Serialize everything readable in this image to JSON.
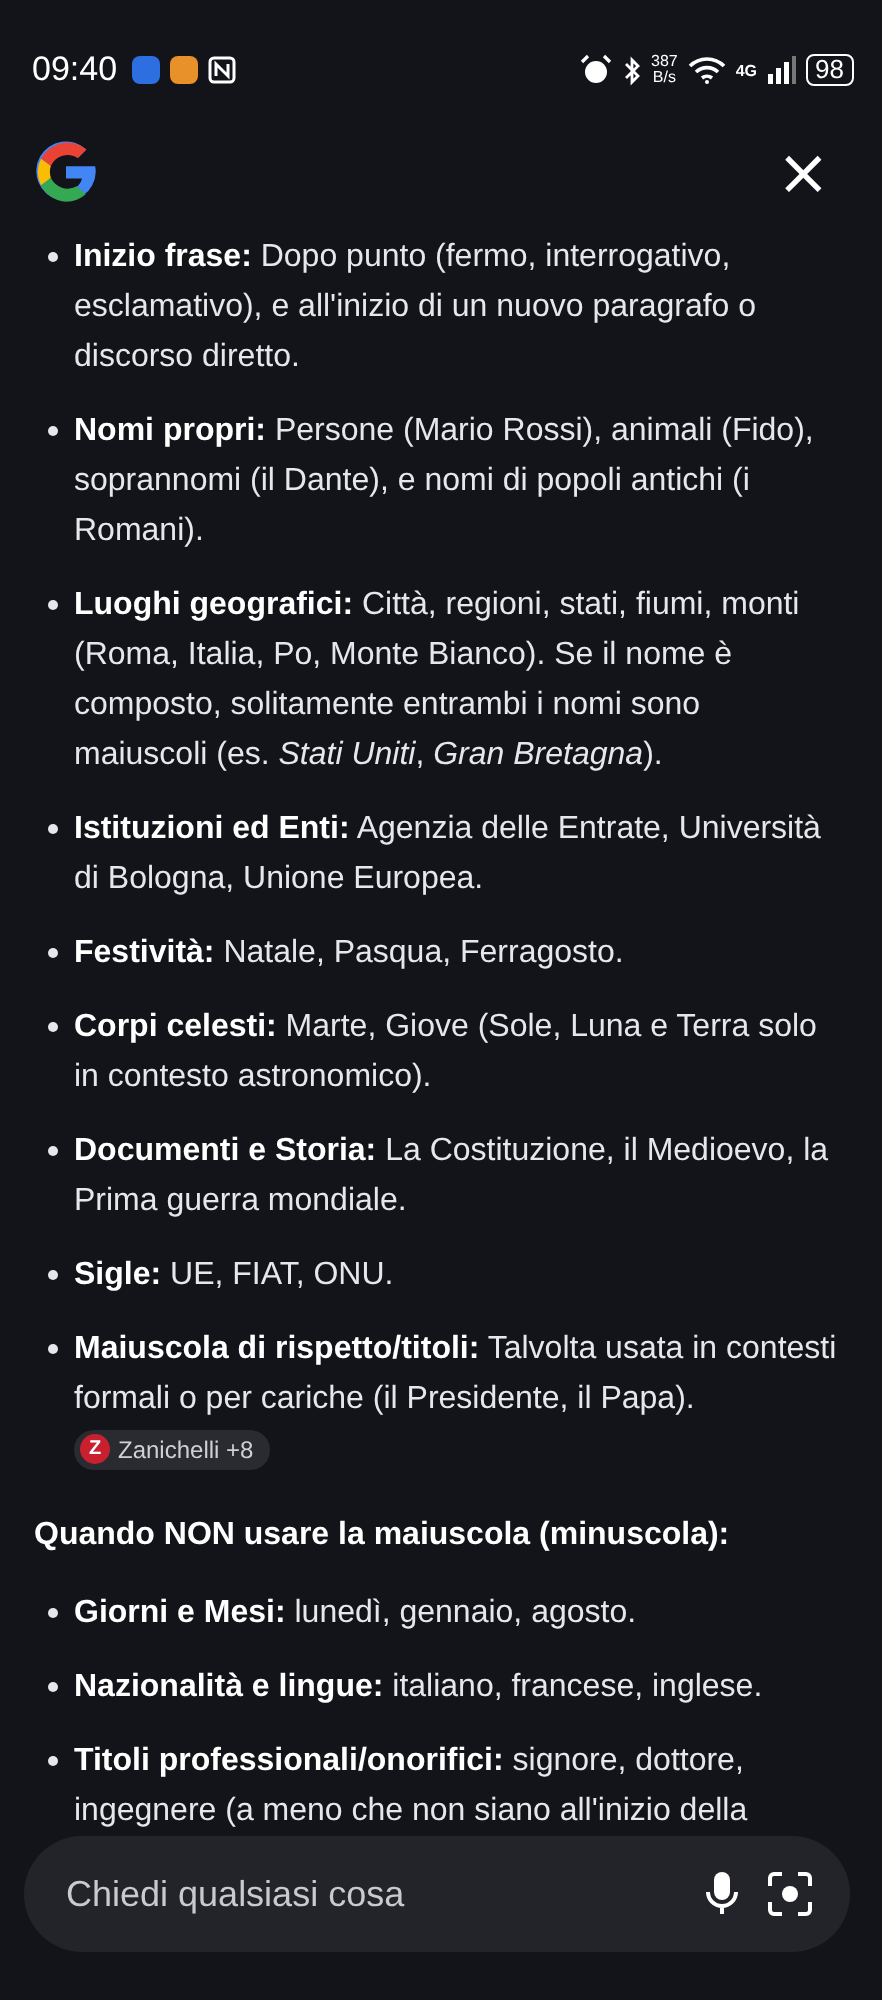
{
  "status_bar": {
    "time": "09:40",
    "net_speed": "387",
    "net_unit": "B/s",
    "network": "4G",
    "battery": "98"
  },
  "header": {
    "close_label": "×"
  },
  "items": [
    {
      "text": "**Inizio frase:** Dopo punto (fermo, interrogativo, esclamativo), e all'inizio di un nuovo paragrafo o discorso diretto."
    },
    {
      "text": "**Nomi propri:** Persone (Mario Rossi), animali (Fido), soprannomi (il Dante), e nomi di popoli antichi (i Romani)."
    },
    {
      "text": "**Luoghi geografici:** Città, regioni, stati, fiumi, monti (Roma, Italia, Po, Monte Bianco). Se il nome è composto, solitamente entrambi i nomi sono maiuscoli (es. *Stati Uniti*, *Gran Bretagna*)."
    },
    {
      "text": "**Istituzioni ed Enti:** Agenzia delle Entrate, Università di Bologna, Unione Europea."
    },
    {
      "text": "**Festività:** Natale, Pasqua, Ferragosto."
    },
    {
      "text": "**Corpi celesti:** Marte, Giove (Sole, Luna e Terra solo in contesto astronomico)."
    },
    {
      "text": "**Documenti e Storia:** La Costituzione, il Medioevo, la Prima guerra mondiale."
    },
    {
      "text": "**Sigle:** UE, FIAT, ONU."
    },
    {
      "text": "**Maiuscola di rispetto/titoli:** Talvolta usata in contesti formali o per cariche (il Presidente, il Papa).",
      "source": {
        "initial": "Z",
        "label": "Zanichelli +8"
      }
    }
  ],
  "heading": "Quando NON usare la maiuscola (minuscola):",
  "items2": [
    {
      "text": "**Giorni e Mesi:** lunedì, gennaio, agosto."
    },
    {
      "text": "**Nazionalità e lingue:** italiano, francese, inglese."
    },
    {
      "text": "**Titoli professionali/onorifici:** signore, dottore, ingegnere (a meno che non siano all'inizio della"
    }
  ],
  "search": {
    "placeholder": "Chiedi qualsiasi cosa"
  }
}
